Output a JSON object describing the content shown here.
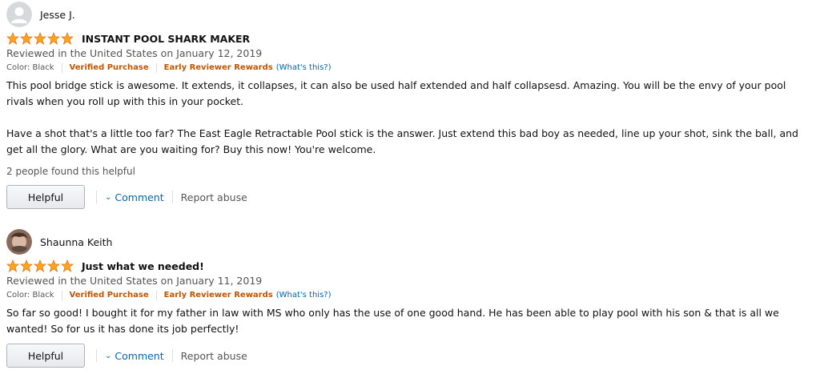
{
  "reviews": [
    {
      "reviewer": "Jesse J.",
      "title": "INSTANT POOL SHARK MAKER",
      "rating": 5,
      "date": "Reviewed in the United States on January 12, 2019",
      "color": "Color: Black",
      "verified": "Verified Purchase",
      "early": "Early Reviewer Rewards",
      "whats_this": "(What's this?)",
      "paragraphs": [
        "This pool bridge stick is awesome. It extends, it collapses, it can also be used half extended and half collapsesd. Amazing. You will be the envy of your pool rivals when you roll up with this in your pocket.",
        "Have a shot that's a little too far? The East Eagle Retractable Pool stick is the answer. Just extend this bad boy as needed, line up your shot, sink the ball, and get all the glory. What are you waiting for? Buy this now! You're welcome."
      ],
      "helpful_count": "2 people found this helpful",
      "helpful_label": "Helpful",
      "comment_label": "Comment",
      "report_label": "Report abuse"
    },
    {
      "reviewer": "Shaunna Keith",
      "title": "Just what we needed!",
      "rating": 5,
      "date": "Reviewed in the United States on January 11, 2019",
      "color": "Color: Black",
      "verified": "Verified Purchase",
      "early": "Early Reviewer Rewards",
      "whats_this": "(What's this?)",
      "paragraphs": [
        "So far so good! I bought it for my father in law with MS who only has the use of one good hand. He has been able to play pool with his son & that is all we wanted! So for us it has done its job perfectly!"
      ],
      "helpful_label": "Helpful",
      "comment_label": "Comment",
      "report_label": "Report abuse"
    }
  ],
  "colors": {
    "star": "#ffa41c",
    "verified": "#c45500",
    "link": "#0066c0"
  }
}
